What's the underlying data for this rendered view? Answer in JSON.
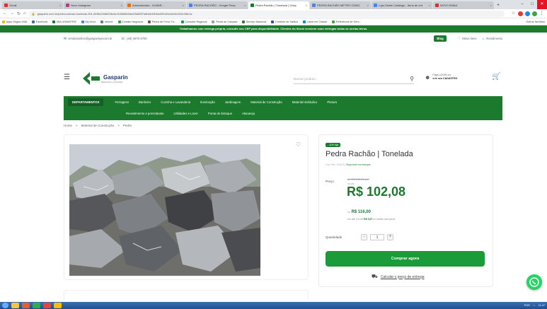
{
  "browser": {
    "tabs": [
      {
        "label": "Gmail",
        "color": "#d93025",
        "active": false
      },
      {
        "label": "Novo Instagram",
        "color": "#c13584",
        "active": false
      },
      {
        "label": "Administrador - M.MAR...",
        "color": "#e8710a",
        "active": false
      },
      {
        "label": "PEDRA RACHÃO - Google Pesq",
        "color": "#4285f4",
        "active": false
      },
      {
        "label": "Pedra Rachão | Tonelada | Gasp",
        "color": "#1c7a2f",
        "active": true
      },
      {
        "label": "PEDRA RACHÃO METRO CÚBIC",
        "color": "#4285f4",
        "active": false
      },
      {
        "label": "Loja Online Catálogo - Itens de ord",
        "color": "#4285f4",
        "active": false
      },
      {
        "label": "NOVO EMAIL",
        "color": "#d93025",
        "active": false
      }
    ],
    "new_tab": "+",
    "url": "gasparin.com.br/pedra-rachao-tonelada-301-8b5b42b8d33bcbc1b5b68b0da4f3d65f7a6b6b49b9a4f81d9ed4c5e2e0e4f8c1a",
    "bookmarks": [
      "Apps Seguro MIA",
      "Facebook",
      "MIA UNIMATRIZ",
      "My Drive",
      "Infonet",
      "Contato Negócios",
      "Pedra de Ferro Fa...",
      "Consulta Regional",
      "Pedra de Calçada",
      "Serviço Nacional",
      "Controle de Saldos",
      "Listar em Cidade",
      "Referência de Serv..."
    ],
    "bookmarks_more": "Outros favoritos"
  },
  "site": {
    "promo_text": "Trabalhamos com entrega própria, consulte seu CEP para disponibilidade. Clientes do litoral recebem suas entregas todas as sextas-feiras.",
    "email": "vendasonline@gasparinpecom.br",
    "phone": "(48) 3675-3700",
    "blog": "Blog",
    "favorites": "Meus itens",
    "service": "Atendimento",
    "logo_name": "Gasparin",
    "logo_tagline": "Material de construção",
    "search_placeholder": "Buscar produto...",
    "login_line1": "Faça LOGIN ou",
    "login_line2": "crie seu CADASTRO",
    "nav_row1": [
      "DEPARTAMENTOS",
      "Ferragens",
      "Banheiro",
      "Cozinha e Lavanderia",
      "Iluminação",
      "Jardinagem",
      "Material de Construção",
      "Material Hidráulico",
      "Pintura"
    ],
    "nav_row2": [
      "Revestimento e porcelanato",
      "Utilidades e Lazer",
      "Ponta de Estoque",
      "Atacarejo"
    ],
    "breadcrumb": [
      "Home",
      ">",
      "Material de Construção",
      ">",
      "Pedra"
    ]
  },
  "product": {
    "badge": "- 11% loja",
    "title": "Pedra Rachão | Tonelada",
    "sku_label": "Cód. Ref: 101123 |",
    "stock": "Disponível em estoque",
    "price_label": "Preço",
    "old_price": "de R$ 115,00 por",
    "por_label": "no pix",
    "price": "R$ 102,08",
    "price_alt_prefix": "ou",
    "price_alt": "R$ 116,00",
    "installment_prefix": "em até 12x de",
    "installment_value": "R$ 9,67",
    "installment_suffix": "no cartão sem juros",
    "qty_label": "Quantidade",
    "qty_value": "1",
    "qty_minus": "-",
    "qty_plus": "+",
    "buy_label": "Comprar agora",
    "shipping_label": "Calcular o preço de entrega"
  },
  "taskbar": {
    "clock": "11:47",
    "lang": "POR"
  }
}
